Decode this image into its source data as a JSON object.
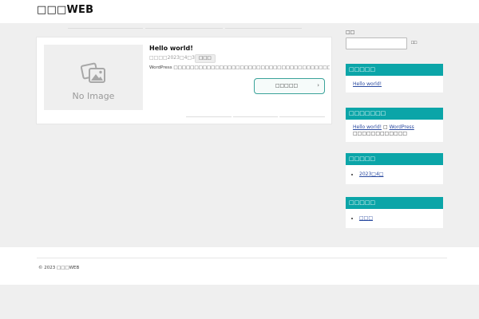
{
  "header": {
    "site_title": "□□□WEB"
  },
  "post": {
    "thumbnail_text": "No Image",
    "title": "Hello world!",
    "date": "□□□□2023□4□3□",
    "category": "□□□",
    "excerpt": "WordPress □□□□□□□□□□□□□□□□□□□□□□□□□□□□□□□□□□□□□□□□□□□□□□□□□□□□□□",
    "read_more": "□□□□□",
    "read_more_icon": "chevron-right-icon"
  },
  "sidebar": {
    "search": {
      "label": "□□",
      "value": "",
      "button": "□□"
    },
    "recent_posts": {
      "title": "□□□□□",
      "items": [
        "Hello world!"
      ]
    },
    "recent_comments": {
      "title": "□□□□□□□",
      "comment": {
        "author": "Hello world!",
        "connector": "□",
        "post": "WordPress",
        "tail": "□□□□□□□□□□□□"
      }
    },
    "archives": {
      "title": "□□□□□",
      "items": [
        "2023□4□"
      ]
    },
    "categories": {
      "title": "□□□□□",
      "items": [
        "□□□"
      ]
    }
  },
  "footer": {
    "copyright": "© 2023 □□□WEB"
  },
  "colors": {
    "accent": "#0ba5a8",
    "button_border": "#3aa39a",
    "link": "#2a4aa0",
    "background": "#efefef"
  }
}
